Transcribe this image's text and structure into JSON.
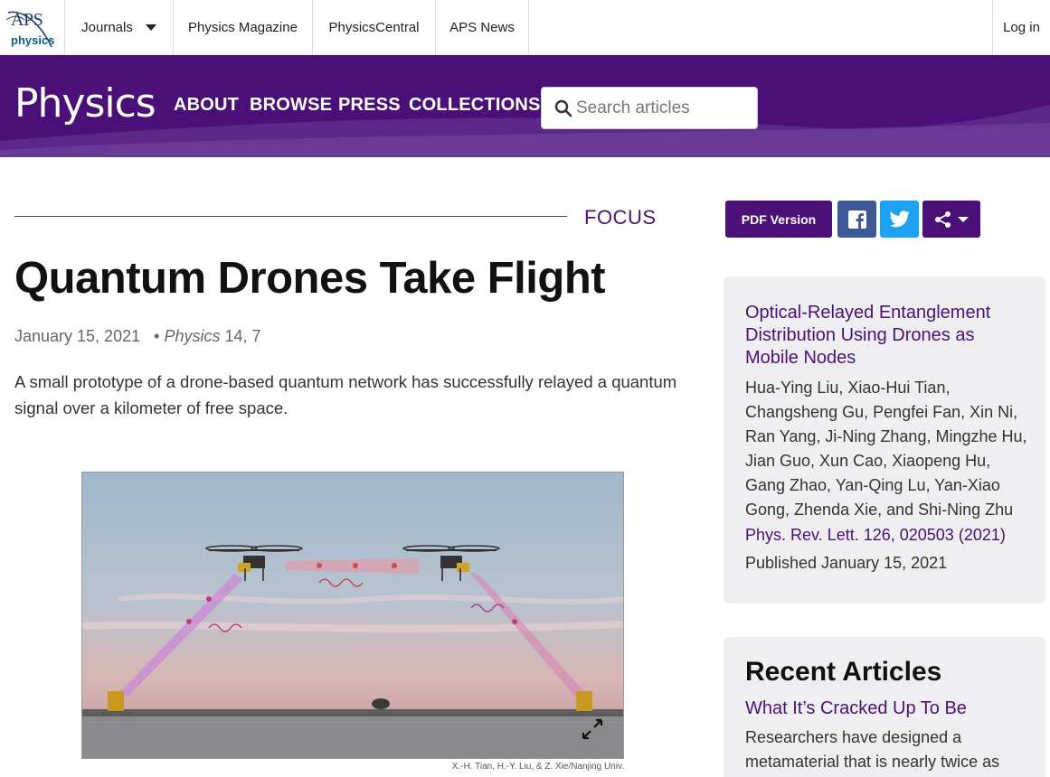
{
  "aps_logo": {
    "text": "APS",
    "sub": "physics"
  },
  "topnav": {
    "journals": "Journals",
    "magazine": "Physics Magazine",
    "central": "PhysicsCentral",
    "news": "APS News",
    "login": "Log in"
  },
  "header": {
    "logo": "Physics",
    "nav": {
      "about": "ABOUT",
      "browse": "BROWSE",
      "press": "PRESS",
      "collections": "COLLECTIONS"
    },
    "search_placeholder": "Search articles"
  },
  "article": {
    "section": "FOCUS",
    "title": "Quantum Drones Take Flight",
    "date": "January 15, 2021",
    "journal": "Physics",
    "volume": " 14, 7",
    "summary": "A small prototype of a drone-based quantum network has successfully relayed a quantum signal over a kilometer of free space.",
    "figure_credit": "X.-H. Tian, H.-Y. Liu, & Z. Xie/Nanjing Univ."
  },
  "sidebar": {
    "pdf_label": "PDF Version",
    "paper": {
      "title": "Optical-Relayed Entanglement Distribution Using Drones as Mobile Nodes",
      "authors": "Hua-Ying Liu, Xiao-Hui Tian, Changsheng Gu, Pengfei Fan, Xin Ni, Ran Yang, Ji-Ning Zhang, Mingzhe Hu, Jian Guo, Xun Cao, Xiaopeng Hu, Gang Zhao, Yan-Qing Lu, Yan-Xiao Gong, Zhenda Xie, and Shi-Ning Zhu",
      "reference": "Phys. Rev. Lett. 126, 020503 (2021)",
      "published": "Published January 15, 2021"
    },
    "recent": {
      "heading": "Recent Articles",
      "item_title": "What It’s Cracked Up To Be",
      "item_text": "Researchers have designed a metamaterial that is nearly twice as"
    }
  },
  "colors": {
    "brand": "#4a1078",
    "facebook": "#3b5998",
    "twitter": "#1da1f2"
  },
  "icons": [
    "search-icon",
    "facebook-icon",
    "twitter-icon",
    "share-icon",
    "expand-icon",
    "chevron-down-icon"
  ]
}
